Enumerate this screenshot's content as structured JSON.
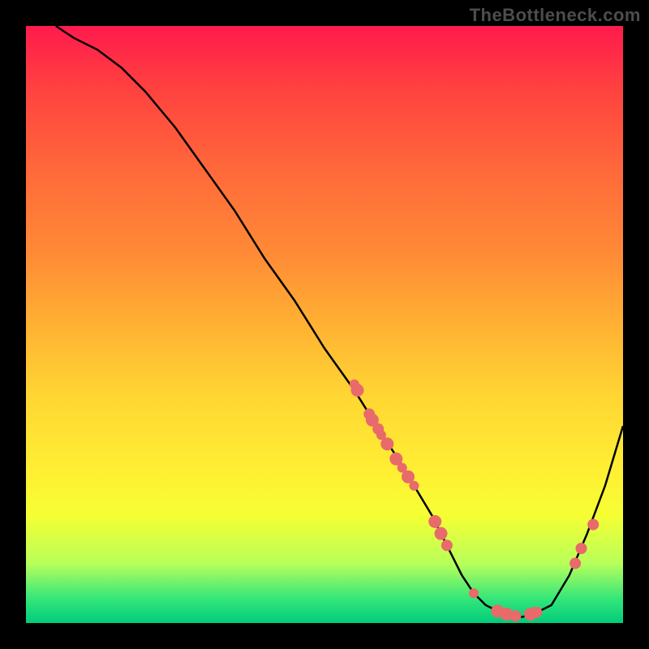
{
  "watermark": "TheBottleneck.com",
  "colors": {
    "bg": "#000000",
    "curve": "#000000",
    "dot": "#e86a6a",
    "gradient_top": "#ff1a4d",
    "gradient_bottom": "#00cc7a"
  },
  "chart_data": {
    "type": "line",
    "title": "",
    "xlabel": "",
    "ylabel": "",
    "xlim": [
      0,
      100
    ],
    "ylim": [
      0,
      100
    ],
    "series": [
      {
        "name": "bottleneck-curve",
        "x": [
          5,
          8,
          12,
          16,
          20,
          25,
          30,
          35,
          40,
          45,
          50,
          55,
          60,
          62,
          65,
          68,
          71,
          73,
          75,
          77,
          80,
          83,
          85,
          88,
          91,
          94,
          97,
          100
        ],
        "y": [
          100,
          98,
          96,
          93,
          89,
          83,
          76,
          69,
          61,
          54,
          46,
          39,
          31,
          28,
          23,
          18,
          12,
          8,
          5,
          3,
          1.5,
          1,
          1.5,
          3,
          8,
          15,
          23,
          33
        ]
      }
    ],
    "scatter": {
      "name": "highlight-dots",
      "points": [
        {
          "x": 55.0,
          "y": 40.0,
          "r": 6
        },
        {
          "x": 55.5,
          "y": 39.0,
          "r": 8
        },
        {
          "x": 57.5,
          "y": 35.0,
          "r": 7
        },
        {
          "x": 58.0,
          "y": 34.0,
          "r": 8
        },
        {
          "x": 59.0,
          "y": 32.5,
          "r": 7
        },
        {
          "x": 59.5,
          "y": 31.5,
          "r": 6
        },
        {
          "x": 60.5,
          "y": 30.0,
          "r": 8
        },
        {
          "x": 62.0,
          "y": 27.5,
          "r": 8
        },
        {
          "x": 63.0,
          "y": 26.0,
          "r": 6
        },
        {
          "x": 64.0,
          "y": 24.5,
          "r": 8
        },
        {
          "x": 65.0,
          "y": 23.0,
          "r": 6
        },
        {
          "x": 68.5,
          "y": 17.0,
          "r": 8
        },
        {
          "x": 69.5,
          "y": 15.0,
          "r": 8
        },
        {
          "x": 70.5,
          "y": 13.0,
          "r": 7
        },
        {
          "x": 75.0,
          "y": 5.0,
          "r": 6
        },
        {
          "x": 79.0,
          "y": 2.0,
          "r": 8
        },
        {
          "x": 80.5,
          "y": 1.5,
          "r": 8
        },
        {
          "x": 82.0,
          "y": 1.2,
          "r": 7
        },
        {
          "x": 84.5,
          "y": 1.5,
          "r": 8
        },
        {
          "x": 85.5,
          "y": 1.8,
          "r": 7
        },
        {
          "x": 92.0,
          "y": 10.0,
          "r": 7
        },
        {
          "x": 93.0,
          "y": 12.5,
          "r": 7
        },
        {
          "x": 95.0,
          "y": 16.5,
          "r": 7
        }
      ]
    }
  }
}
